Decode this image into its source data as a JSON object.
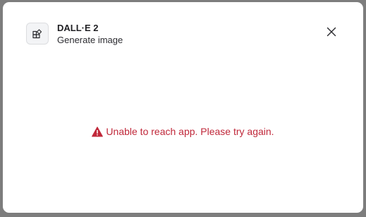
{
  "dialog": {
    "app_name": "DALL·E 2",
    "app_action": "Generate image",
    "icons": {
      "app": "shapes-icon",
      "close": "close-icon",
      "warning": "warning-triangle-icon"
    },
    "error_message": "Unable to reach app. Please try again.",
    "colors": {
      "error": "#c0283a",
      "backdrop": "#7d7d7d"
    }
  }
}
